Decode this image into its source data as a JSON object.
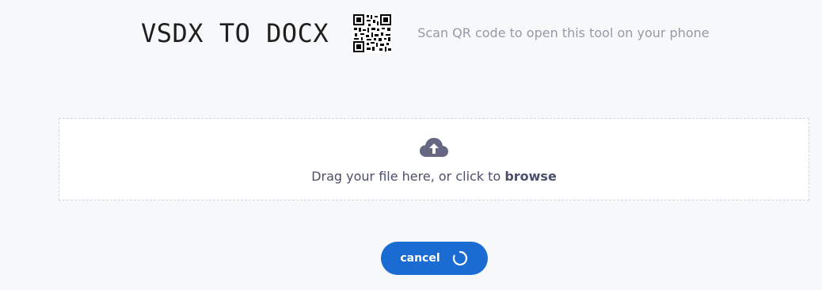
{
  "header": {
    "title": "VSDX TO DOCX",
    "qr_hint": "Scan QR code to open this tool on your phone",
    "qr_icon": "qr-code-icon"
  },
  "dropzone": {
    "icon": "cloud-upload-icon",
    "text_prefix": "Drag your file here, or click to ",
    "browse_label": "browse"
  },
  "actions": {
    "cancel_label": "cancel",
    "spinner_icon": "loading-spinner-icon"
  },
  "colors": {
    "accent": "#1a6bd2",
    "text_primary": "#1f1f1f",
    "text_muted": "#959aa6",
    "dropzone_text": "#4b4f6b",
    "background": "#f7f8fa"
  }
}
